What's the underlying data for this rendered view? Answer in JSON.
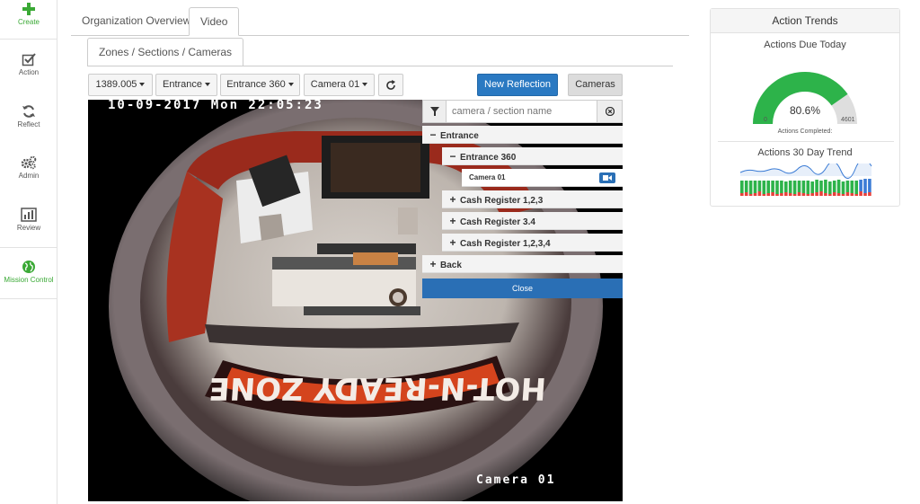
{
  "sidebar": {
    "items": [
      {
        "id": "create",
        "label": "Create",
        "icon": "plus-icon"
      },
      {
        "id": "action",
        "label": "Action",
        "icon": "checkbox-icon"
      },
      {
        "id": "reflect",
        "label": "Reflect",
        "icon": "refresh-icon"
      },
      {
        "id": "admin",
        "label": "Admin",
        "icon": "gears-icon"
      },
      {
        "id": "review",
        "label": "Review",
        "icon": "bar-chart-icon"
      },
      {
        "id": "mission",
        "label": "Mission Control",
        "icon": "globe-icon"
      }
    ]
  },
  "tabs": {
    "overview": "Organization Overview",
    "video": "Video",
    "zones": "Zones / Sections / Cameras"
  },
  "toolbar": {
    "store": "1389.005",
    "zone": "Entrance",
    "section": "Entrance 360",
    "camera": "Camera 01",
    "new_reflection": "New Reflection",
    "cameras": "Cameras"
  },
  "camera_view": {
    "timestamp": "10-09-2017 Mon 22:05:23",
    "name": "Camera 01"
  },
  "tree": {
    "search_placeholder": "camera / section name",
    "zone": "Entrance",
    "section_open": "Entrance 360",
    "camera": "Camera 01",
    "sections": [
      "Cash Register 1,2,3",
      "Cash Register 3.4",
      "Cash Register 1,2,3,4"
    ],
    "back": "Back",
    "close": "Close"
  },
  "trends": {
    "title": "Action Trends",
    "due_title": "Actions Due Today",
    "percent": "80.6%",
    "percent_value": 0.806,
    "min": "0",
    "max": "4601",
    "caption": "Actions Completed:",
    "trend_title": "Actions 30 Day Trend",
    "colors": {
      "green": "#2db34a",
      "gray": "#dedede",
      "red": "#e8403a",
      "blue": "#3a7bd5"
    }
  }
}
